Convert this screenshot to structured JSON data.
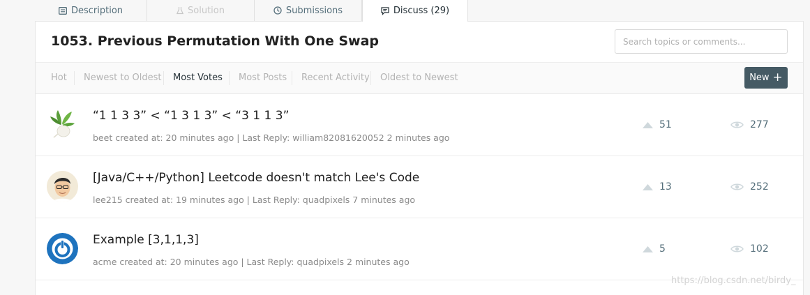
{
  "tabs": [
    {
      "label": "Description",
      "icon": "description-icon"
    },
    {
      "label": "Solution",
      "icon": "flask-icon"
    },
    {
      "label": "Submissions",
      "icon": "clock-icon"
    },
    {
      "label": "Discuss (29)",
      "icon": "comment-icon"
    }
  ],
  "header": {
    "title": "1053. Previous Permutation With One Swap",
    "search_placeholder": "Search topics or comments..."
  },
  "sort_options": [
    "Hot",
    "Newest to Oldest",
    "Most Votes",
    "Most Posts",
    "Recent Activity",
    "Oldest to Newest"
  ],
  "active_sort": "Most Votes",
  "new_button": {
    "label": "New",
    "icon": "plus-icon"
  },
  "topics": [
    {
      "title": "“1 1 3 3” < “1 3 1 3” < “3 1 1 3”",
      "meta": "beet created at: 20 minutes ago | Last Reply: william82081620052 2 minutes ago",
      "votes": "51",
      "views": "277"
    },
    {
      "title": "[Java/C++/Python] Leetcode doesn't match Lee's Code",
      "meta": "lee215 created at: 19 minutes ago | Last Reply: quadpixels 7 minutes ago",
      "votes": "13",
      "views": "252"
    },
    {
      "title": "Example [3,1,1,3]",
      "meta": "acme created at: 20 minutes ago | Last Reply: quadpixels 2 minutes ago",
      "votes": "5",
      "views": "102"
    }
  ],
  "watermark": "https://blog.csdn.net/birdy_",
  "colors": {
    "accent": "#455a64",
    "text": "#263238",
    "muted": "#8a8a8a"
  }
}
